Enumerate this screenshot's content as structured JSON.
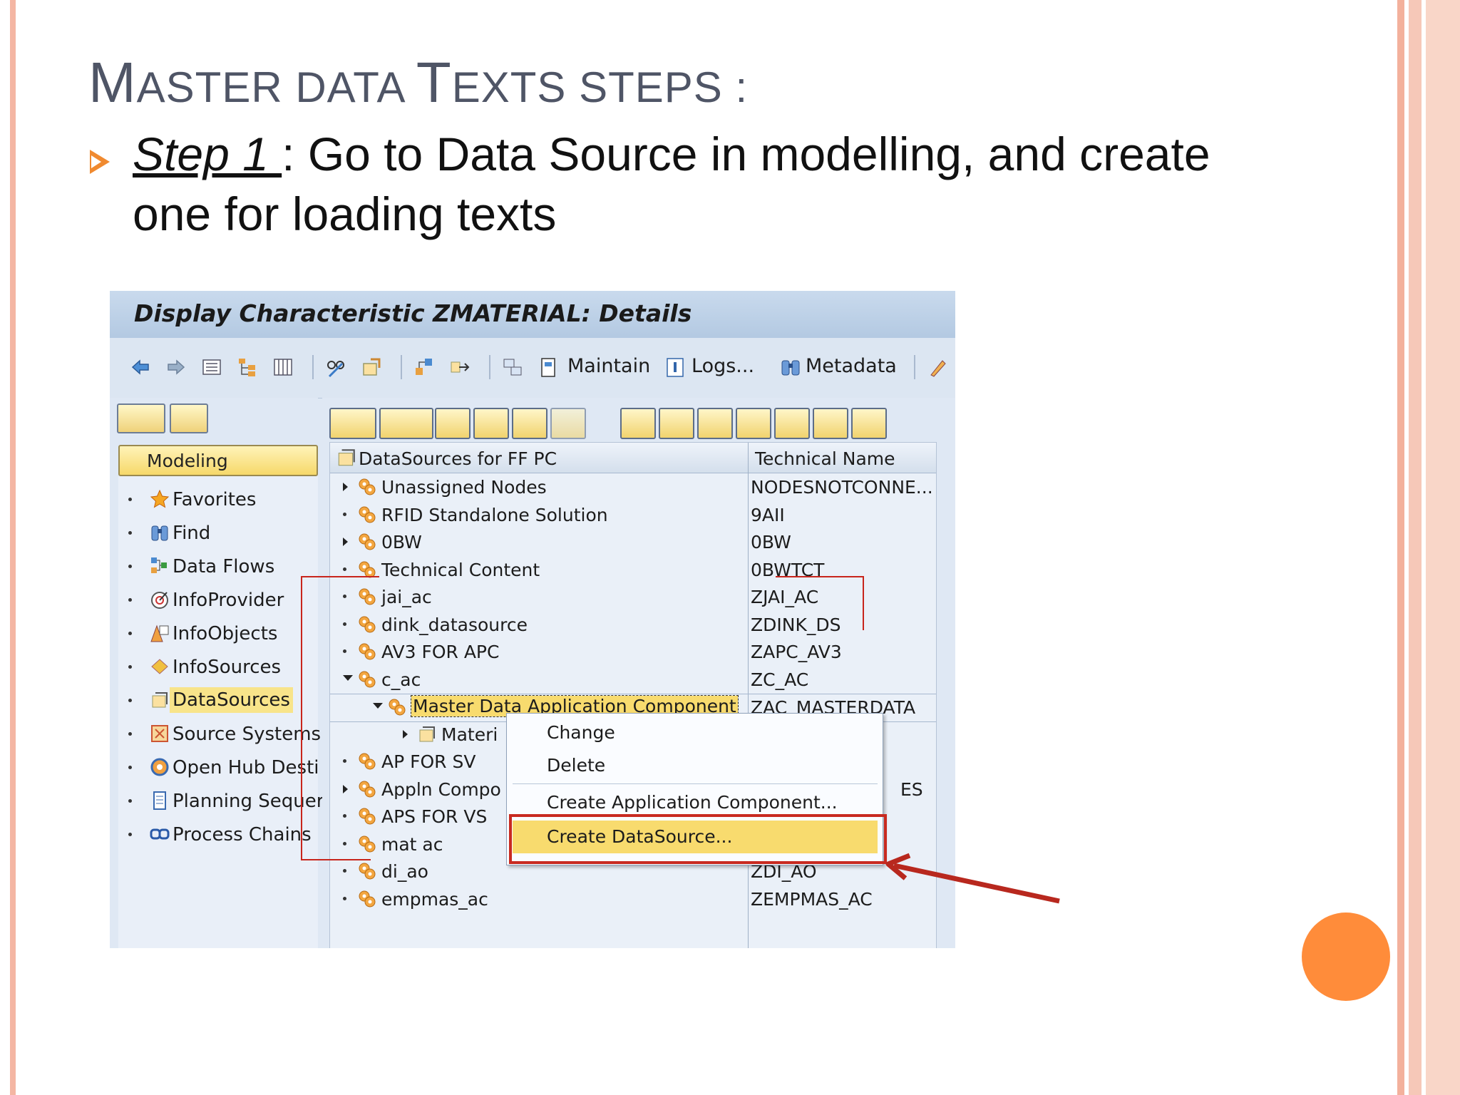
{
  "slide": {
    "title_first": "M",
    "title_rest1": "ASTER DATA ",
    "title_t": "T",
    "title_rest2": "EXTS STEPS :",
    "step_label": "Step 1 ",
    "step_text": ": Go to Data Source in modelling, and create",
    "step_text2": "one for loading texts"
  },
  "window": {
    "title": "Display Characteristic ZMATERIAL: Details",
    "toolbar": {
      "maintain": "Maintain",
      "logs": "Logs...",
      "metadata": "Metadata"
    }
  },
  "left_panel": {
    "modeling_label": "Modeling",
    "items": [
      {
        "label": "Favorites",
        "icon": "star-icon"
      },
      {
        "label": "Find",
        "icon": "binoculars-icon"
      },
      {
        "label": "Data Flows",
        "icon": "dataflow-icon"
      },
      {
        "label": "InfoProvider",
        "icon": "infoprovider-icon"
      },
      {
        "label": "InfoObjects",
        "icon": "infoobject-icon"
      },
      {
        "label": "InfoSources",
        "icon": "infosource-icon"
      },
      {
        "label": "DataSources",
        "icon": "datasource-icon"
      },
      {
        "label": "Source Systems",
        "icon": "source-system-icon"
      },
      {
        "label": "Open Hub Desti",
        "icon": "open-hub-icon"
      },
      {
        "label": "Planning Sequer",
        "icon": "planning-icon"
      },
      {
        "label": "Process Chains",
        "icon": "process-chain-icon"
      }
    ]
  },
  "tree": {
    "col1": "DataSources for FF PC",
    "col2": "Technical Name",
    "rows": [
      {
        "name": "Unassigned Nodes",
        "tech": "NODESNOTCONNE..."
      },
      {
        "name": "RFID Standalone Solution",
        "tech": "9AII"
      },
      {
        "name": "0BW",
        "tech": "0BW"
      },
      {
        "name": "Technical Content",
        "tech": "0BWTCT"
      },
      {
        "name": "jai_ac",
        "tech": "ZJAI_AC"
      },
      {
        "name": "dink_datasource",
        "tech": "ZDINK_DS"
      },
      {
        "name": "AV3 FOR APC",
        "tech": "ZAPC_AV3"
      },
      {
        "name": "c_ac",
        "tech": "ZC_AC"
      },
      {
        "name": "Master Data Application Component",
        "tech": "ZAC_MASTERDATA"
      },
      {
        "name": "Materi",
        "tech": ""
      },
      {
        "name": "AP FOR SV",
        "tech": ""
      },
      {
        "name": "Appln Compo",
        "tech": "ES"
      },
      {
        "name": "APS FOR VS",
        "tech": ""
      },
      {
        "name": "mat ac",
        "tech": ""
      },
      {
        "name": "di_ao",
        "tech": "ZDI_AO"
      },
      {
        "name": "empmas_ac",
        "tech": "ZEMPMAS_AC"
      }
    ]
  },
  "context_menu": {
    "change": "Change",
    "delete": "Delete",
    "create_app_component": "Create Application Component...",
    "create_datasource": "Create DataSource..."
  },
  "colors": {
    "accent": "#ff8c3a",
    "highlight": "#c8251c",
    "title_gray": "#4f5566"
  }
}
